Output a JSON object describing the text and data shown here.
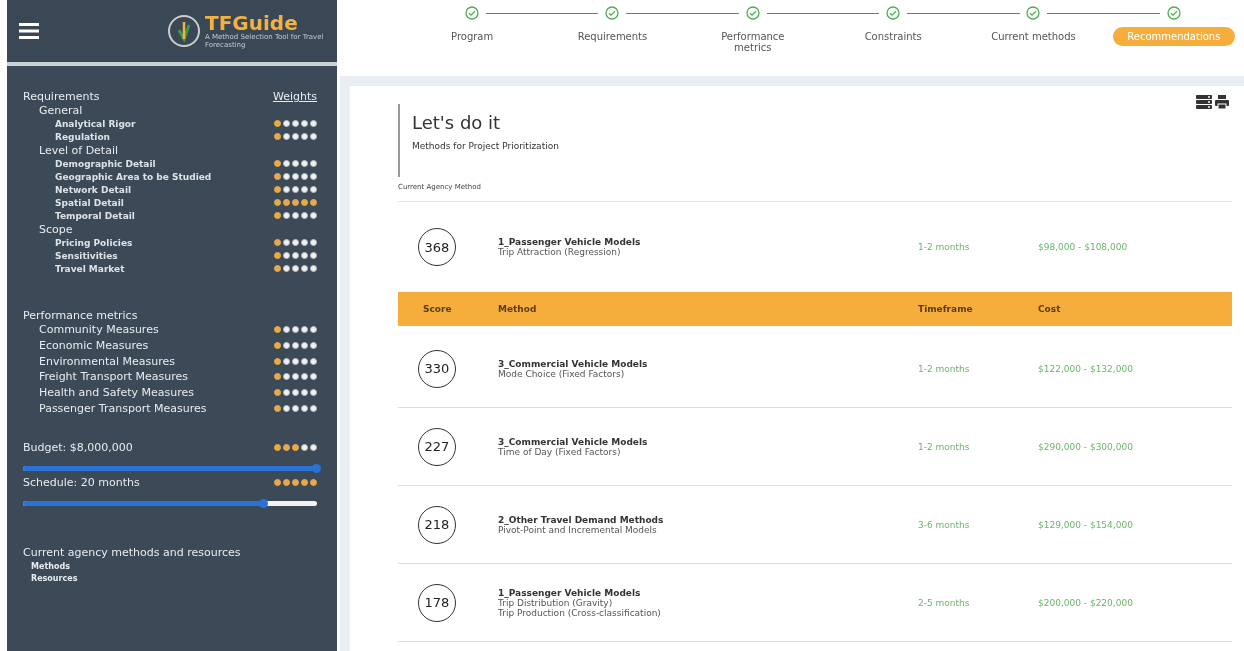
{
  "sidebar": {
    "logo": {
      "name": "TFGuide",
      "tagline": "A Method Selection Tool for Travel Forecasting"
    },
    "requirements": {
      "title": "Requirements",
      "weights_label": "Weights",
      "groups": [
        {
          "label": "General",
          "children": [
            {
              "label": "Analytical Rigor",
              "stars": 1
            },
            {
              "label": "Regulation",
              "stars": 1
            }
          ]
        },
        {
          "label": "Level of Detail",
          "children": [
            {
              "label": "Demographic Detail",
              "stars": 1
            },
            {
              "label": "Geographic Area to be Studied",
              "stars": 1
            },
            {
              "label": "Network Detail",
              "stars": 1
            },
            {
              "label": "Spatial Detail",
              "stars": 5
            },
            {
              "label": "Temporal Detail",
              "stars": 1
            }
          ]
        },
        {
          "label": "Scope",
          "children": [
            {
              "label": "Pricing Policies",
              "stars": 1
            },
            {
              "label": "Sensitivities",
              "stars": 1
            },
            {
              "label": "Travel Market",
              "stars": 1
            }
          ]
        }
      ]
    },
    "performance": {
      "title": "Performance metrics",
      "items": [
        {
          "label": "Community Measures",
          "stars": 1
        },
        {
          "label": "Economic Measures",
          "stars": 1
        },
        {
          "label": "Environmental Measures",
          "stars": 1
        },
        {
          "label": "Freight Transport Measures",
          "stars": 1
        },
        {
          "label": "Health and Safety Measures",
          "stars": 1
        },
        {
          "label": "Passenger Transport Measures",
          "stars": 1
        }
      ]
    },
    "constraints": [
      {
        "label": "Budget: $8,000,000",
        "stars": 3,
        "level": 1.0
      },
      {
        "label": "Schedule: 20 months",
        "stars": 5,
        "level": 0.82
      }
    ],
    "resources": {
      "title": "Current agency methods and resources",
      "items": [
        "Methods",
        "Resources"
      ]
    }
  },
  "stepper": [
    {
      "label": "Program",
      "selected": false
    },
    {
      "label": "Requirements",
      "selected": false
    },
    {
      "label": "Performance metrics",
      "selected": false
    },
    {
      "label": "Constraints",
      "selected": false
    },
    {
      "label": "Current methods",
      "selected": false
    },
    {
      "label": "Recommendations",
      "selected": true
    }
  ],
  "content": {
    "title": "Let's do it",
    "subtitle": "Methods for Project Prioritization",
    "current_label": "Current Agency Method",
    "current": {
      "score": "368",
      "method": "1_Passenger Vehicle Models",
      "details": [
        "Trip Attraction (Regression)"
      ],
      "timeframe": "1-2 months",
      "cost": "$98,000 - $108,000"
    },
    "table": {
      "columns": [
        "Score",
        "Method",
        "Timeframe",
        "Cost"
      ],
      "rows": [
        {
          "score": "330",
          "method": "3_Commercial Vehicle Models",
          "details": [
            "Mode Choice (Fixed Factors)"
          ],
          "timeframe": "1-2 months",
          "cost": "$122,000 - $132,000"
        },
        {
          "score": "227",
          "method": "3_Commercial Vehicle Models",
          "details": [
            "Time of Day (Fixed Factors)"
          ],
          "timeframe": "1-2 months",
          "cost": "$290,000 - $300,000"
        },
        {
          "score": "218",
          "method": "2_Other Travel Demand Methods",
          "details": [
            "Pivot-Point and Incremental Models"
          ],
          "timeframe": "3-6 months",
          "cost": "$129,000 - $154,000"
        },
        {
          "score": "178",
          "method": "1_Passenger Vehicle Models",
          "details": [
            "Trip Distribution (Gravity)",
            "Trip Production (Cross-classification)"
          ],
          "timeframe": "2-5 months",
          "cost": "$200,000 - $220,000"
        }
      ]
    }
  }
}
